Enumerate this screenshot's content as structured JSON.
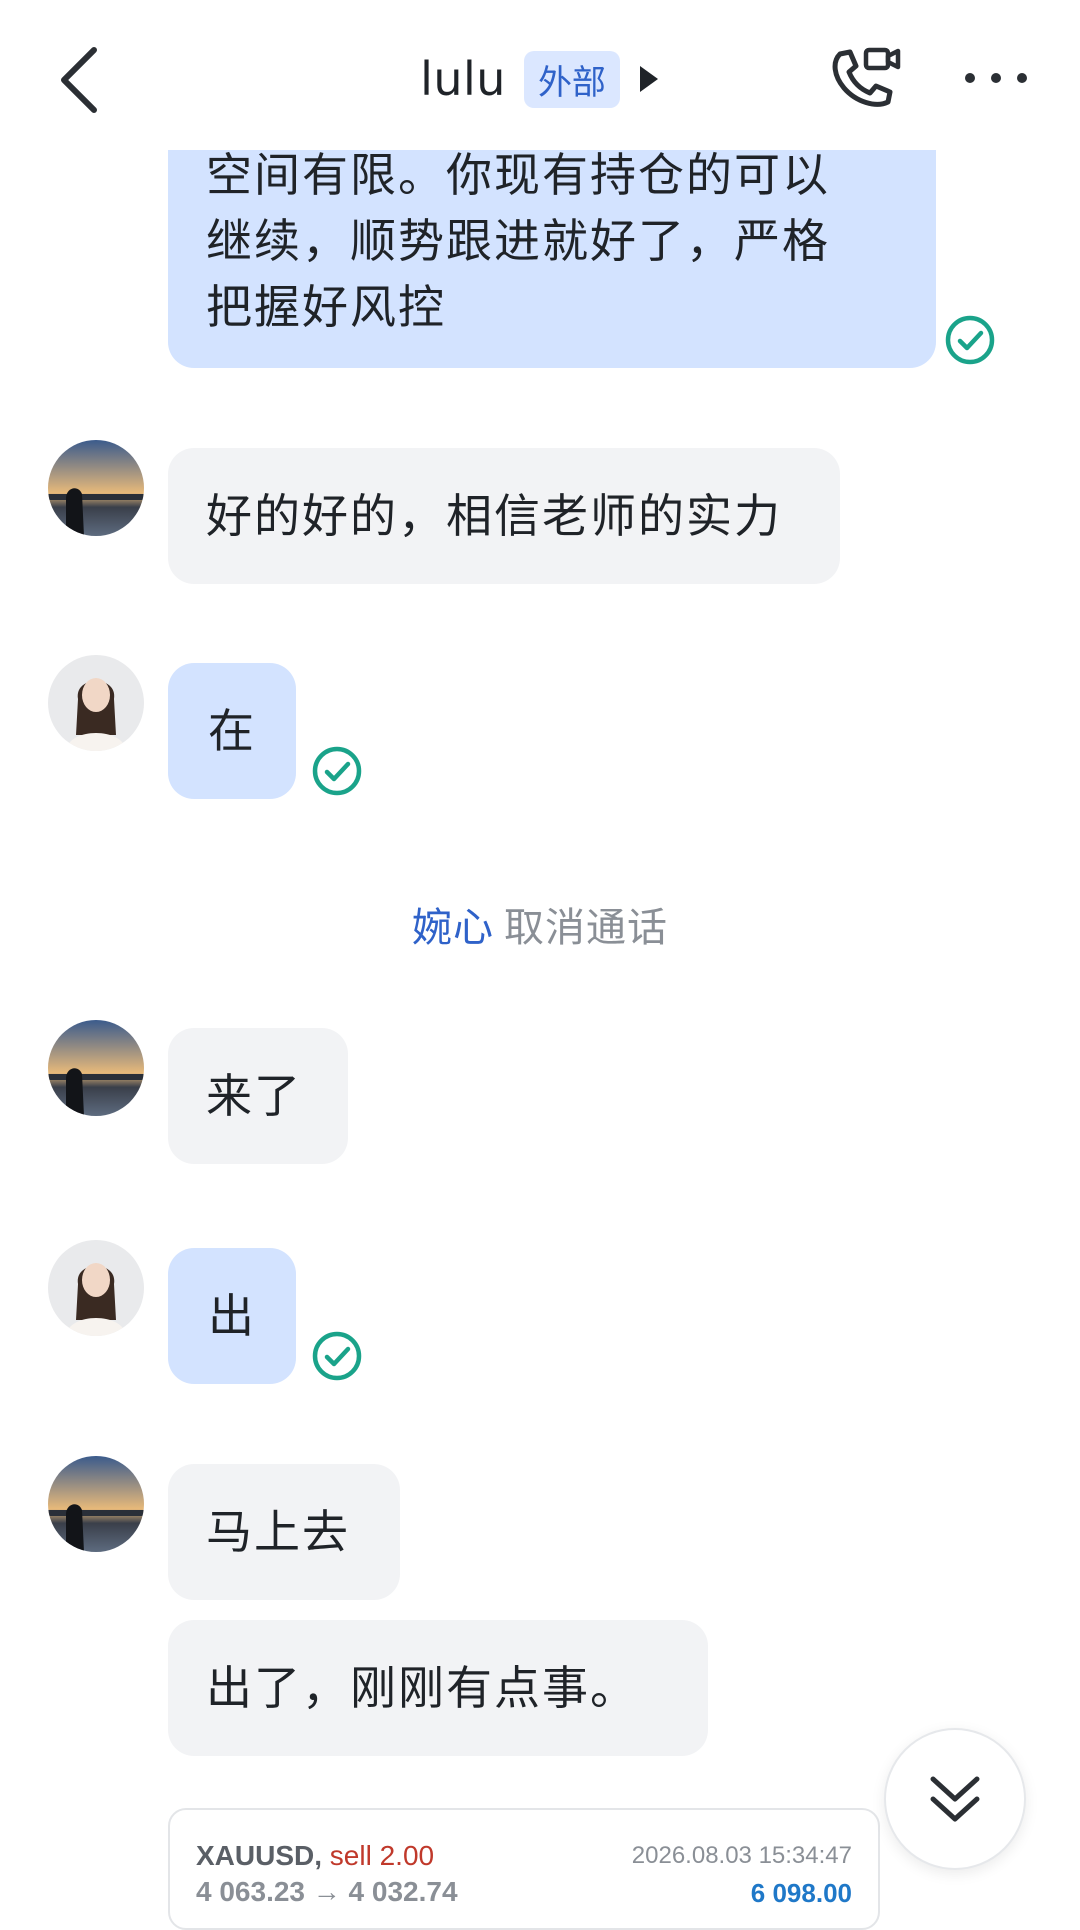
{
  "header": {
    "title": "lulu",
    "badge": "外部",
    "icons": [
      "back-arrow-icon",
      "triangle-right-icon",
      "phone-video-icon",
      "more-dots-icon"
    ]
  },
  "messages": [
    {
      "lines": [
        "空间有限。你现有持仓的可以",
        "继续，顺势跟进就好了，严格",
        "把握好风控"
      ],
      "direction": "sent",
      "status": "read"
    },
    {
      "text": "好的好的，相信老师的实力",
      "direction": "received",
      "avatar": "avatar-lulu"
    },
    {
      "text": "在",
      "direction": "sent",
      "status": "read",
      "avatar": "avatar-wanxin"
    },
    {
      "text": "来了",
      "direction": "received",
      "avatar": "avatar-lulu"
    },
    {
      "text": "出",
      "direction": "sent",
      "status": "read",
      "avatar": "avatar-wanxin"
    },
    {
      "text": "马上去",
      "direction": "received",
      "avatar": "avatar-lulu"
    },
    {
      "text": "出了，刚刚有点事。",
      "direction": "received"
    }
  ],
  "system_notice": {
    "who": "婉心",
    "text": "取消通话"
  },
  "trade_card": {
    "symbol": "XAUUSD,",
    "side": "sell 2.00",
    "prices": "4 063.23 → 4 032.74",
    "datetime": "2026.08.03 15:34:47",
    "profit": "6 098.00"
  },
  "colors": {
    "sent_bubble": "#d3e3ff",
    "received_bubble": "#f2f3f5",
    "read_check": "#1aa38a",
    "accent_blue": "#2f62c9",
    "sell_red": "#c0392b",
    "profit_blue": "#1f78c8"
  }
}
